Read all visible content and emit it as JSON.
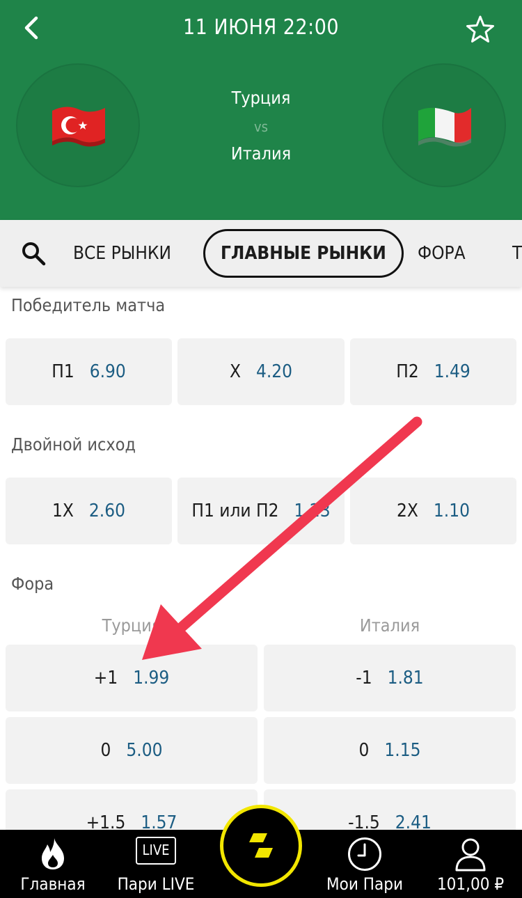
{
  "header": {
    "date": "11 ИЮНЯ 22:00",
    "home_team": "Турция",
    "vs": "vs",
    "away_team": "Италия"
  },
  "tabs": [
    {
      "label": "ВСЕ РЫНКИ",
      "active": false
    },
    {
      "label": "ГЛАВНЫЕ РЫНКИ",
      "active": true
    },
    {
      "label": "ФОРА",
      "active": false
    },
    {
      "label": "Т",
      "active": false
    }
  ],
  "markets": {
    "winner": {
      "title": "Победитель матча",
      "outcomes": [
        {
          "label": "П1",
          "odds": "6.90"
        },
        {
          "label": "X",
          "odds": "4.20"
        },
        {
          "label": "П2",
          "odds": "1.49"
        }
      ]
    },
    "double_chance": {
      "title": "Двойной исход",
      "outcomes": [
        {
          "label": "1X",
          "odds": "2.60"
        },
        {
          "label": "П1 или П2",
          "odds": "1.23"
        },
        {
          "label": "2X",
          "odds": "1.10"
        }
      ]
    },
    "handicap": {
      "title": "Фора",
      "home_header": "Турция",
      "away_header": "Италия",
      "rows": [
        {
          "home_line": "+1",
          "home_odds": "1.99",
          "away_line": "-1",
          "away_odds": "1.81"
        },
        {
          "home_line": "0",
          "home_odds": "5.00",
          "away_line": "0",
          "away_odds": "1.15"
        },
        {
          "home_line": "+1.5",
          "home_odds": "1.57",
          "away_line": "-1.5",
          "away_odds": "2.41"
        }
      ]
    }
  },
  "bottom_nav": {
    "home": "Главная",
    "live_icon_text": "LIVE",
    "live": "Пари LIVE",
    "my_bets": "Мои Пари",
    "balance": "101,00 ₽"
  },
  "colors": {
    "header_green": "#1f8449",
    "odds_blue": "#1c5d83",
    "arrow_red": "#f0384f",
    "accent_yellow": "#f2e600"
  }
}
